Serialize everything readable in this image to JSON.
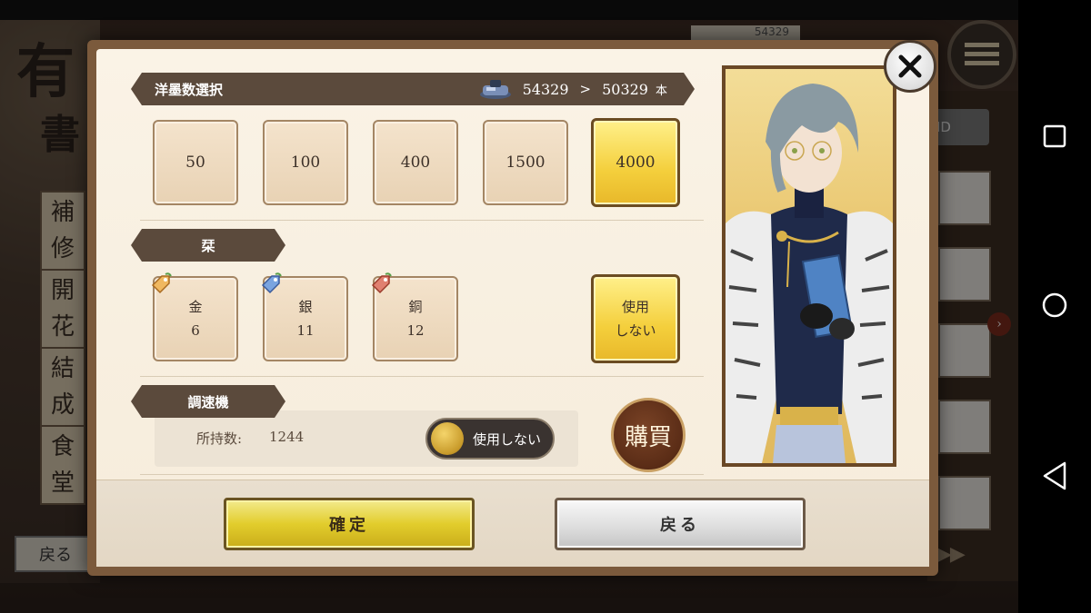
{
  "background": {
    "bg_kanji_top": "有",
    "bg_kanji_second": "書",
    "side_buttons": [
      {
        "line1": "補",
        "line2": "修"
      },
      {
        "line1": "開",
        "line2": "花"
      },
      {
        "line1": "結",
        "line2": "成"
      },
      {
        "line1": "食",
        "line2": "堂"
      }
    ],
    "ink_count": "54329",
    "id_label": "ID",
    "back_label": "戻る",
    "arrows": "▶▶"
  },
  "dialog": {
    "ink_section": {
      "title": "洋墨数選択",
      "from_value": "54329",
      "arrow": ">",
      "to_value": "50329",
      "unit": "本"
    },
    "ink_choices": [
      {
        "label": "50",
        "selected": false
      },
      {
        "label": "100",
        "selected": false
      },
      {
        "label": "400",
        "selected": false
      },
      {
        "label": "1500",
        "selected": false
      },
      {
        "label": "4000",
        "selected": true
      }
    ],
    "bookmark_section": {
      "title": "栞",
      "items": [
        {
          "name": "金",
          "count": "6",
          "tag_color": "#e6a64a"
        },
        {
          "name": "銀",
          "count": "11",
          "tag_color": "#5b8fd6"
        },
        {
          "name": "銅",
          "count": "12",
          "tag_color": "#d86a5a"
        }
      ],
      "none_option": {
        "line1": "使用",
        "line2": "しない",
        "selected": true
      }
    },
    "speed_section": {
      "title": "調速機",
      "owned_label": "所持数:",
      "owned_value": "1244",
      "toggle_label": "使用しない",
      "buy_label": "購買"
    },
    "confirm_label": "確定",
    "back_label": "戻る"
  },
  "colors": {
    "accent_gold": "#f4cf3c",
    "header_brown": "#5b4a3c",
    "frame_brown": "#7b5a3c"
  }
}
